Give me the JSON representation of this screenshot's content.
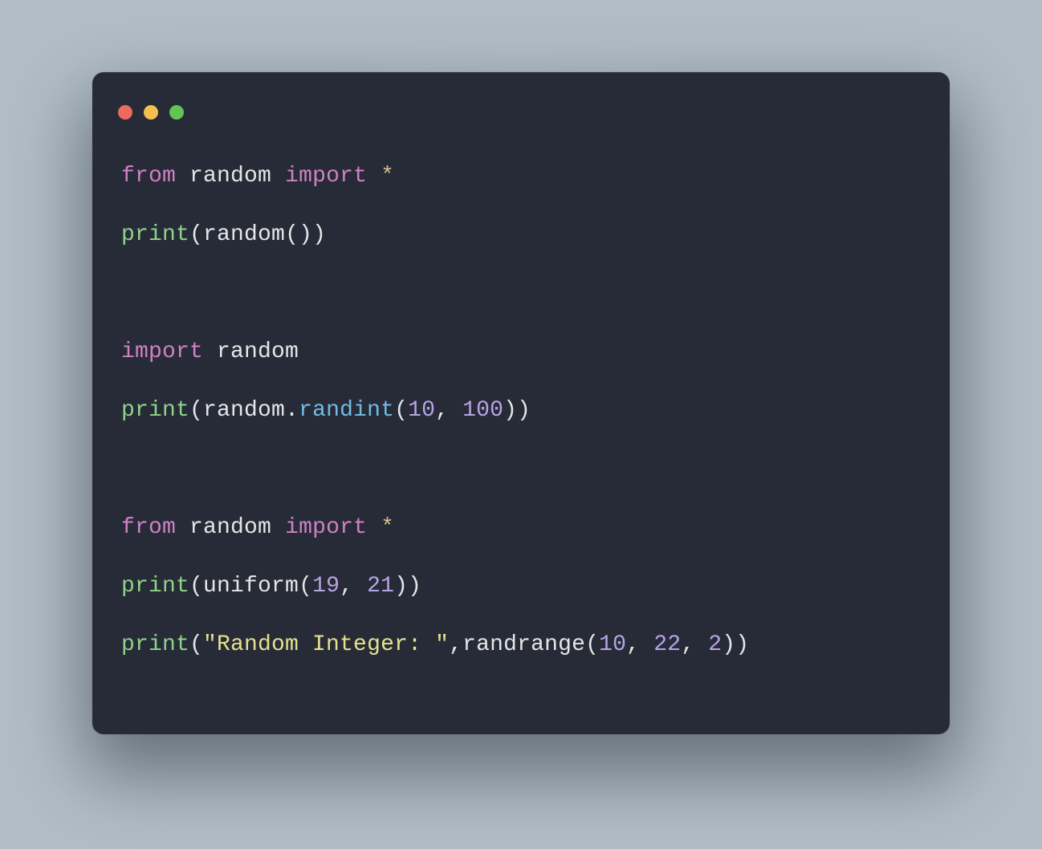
{
  "code": {
    "lines": [
      {
        "type": "code",
        "tokens": [
          {
            "cls": "kw",
            "t": "from"
          },
          {
            "cls": "pn",
            "t": " "
          },
          {
            "cls": "mod",
            "t": "random"
          },
          {
            "cls": "pn",
            "t": " "
          },
          {
            "cls": "kw",
            "t": "import"
          },
          {
            "cls": "pn",
            "t": " "
          },
          {
            "cls": "op",
            "t": "*"
          }
        ]
      },
      {
        "type": "code",
        "tokens": [
          {
            "cls": "fn",
            "t": "print"
          },
          {
            "cls": "pn",
            "t": "("
          },
          {
            "cls": "id",
            "t": "random"
          },
          {
            "cls": "pn",
            "t": "())"
          }
        ]
      },
      {
        "type": "blank"
      },
      {
        "type": "code",
        "tokens": [
          {
            "cls": "kw",
            "t": "import"
          },
          {
            "cls": "pn",
            "t": " "
          },
          {
            "cls": "mod",
            "t": "random"
          }
        ]
      },
      {
        "type": "code",
        "tokens": [
          {
            "cls": "fn",
            "t": "print"
          },
          {
            "cls": "pn",
            "t": "("
          },
          {
            "cls": "id",
            "t": "random"
          },
          {
            "cls": "pn",
            "t": "."
          },
          {
            "cls": "attr",
            "t": "randint"
          },
          {
            "cls": "pn",
            "t": "("
          },
          {
            "cls": "num",
            "t": "10"
          },
          {
            "cls": "pn",
            "t": ", "
          },
          {
            "cls": "num",
            "t": "100"
          },
          {
            "cls": "pn",
            "t": "))"
          }
        ]
      },
      {
        "type": "blank"
      },
      {
        "type": "code",
        "tokens": [
          {
            "cls": "kw",
            "t": "from"
          },
          {
            "cls": "pn",
            "t": " "
          },
          {
            "cls": "mod",
            "t": "random"
          },
          {
            "cls": "pn",
            "t": " "
          },
          {
            "cls": "kw",
            "t": "import"
          },
          {
            "cls": "pn",
            "t": " "
          },
          {
            "cls": "op",
            "t": "*"
          }
        ]
      },
      {
        "type": "code",
        "tokens": [
          {
            "cls": "fn",
            "t": "print"
          },
          {
            "cls": "pn",
            "t": "("
          },
          {
            "cls": "id",
            "t": "uniform"
          },
          {
            "cls": "pn",
            "t": "("
          },
          {
            "cls": "num",
            "t": "19"
          },
          {
            "cls": "pn",
            "t": ", "
          },
          {
            "cls": "num",
            "t": "21"
          },
          {
            "cls": "pn",
            "t": "))"
          }
        ]
      },
      {
        "type": "code",
        "tokens": [
          {
            "cls": "fn",
            "t": "print"
          },
          {
            "cls": "pn",
            "t": "("
          },
          {
            "cls": "str",
            "t": "\"Random Integer: \""
          },
          {
            "cls": "pn",
            "t": ","
          },
          {
            "cls": "id",
            "t": "randrange"
          },
          {
            "cls": "pn",
            "t": "("
          },
          {
            "cls": "num",
            "t": "10"
          },
          {
            "cls": "pn",
            "t": ", "
          },
          {
            "cls": "num",
            "t": "22"
          },
          {
            "cls": "pn",
            "t": ", "
          },
          {
            "cls": "num",
            "t": "2"
          },
          {
            "cls": "pn",
            "t": "))"
          }
        ]
      }
    ]
  }
}
